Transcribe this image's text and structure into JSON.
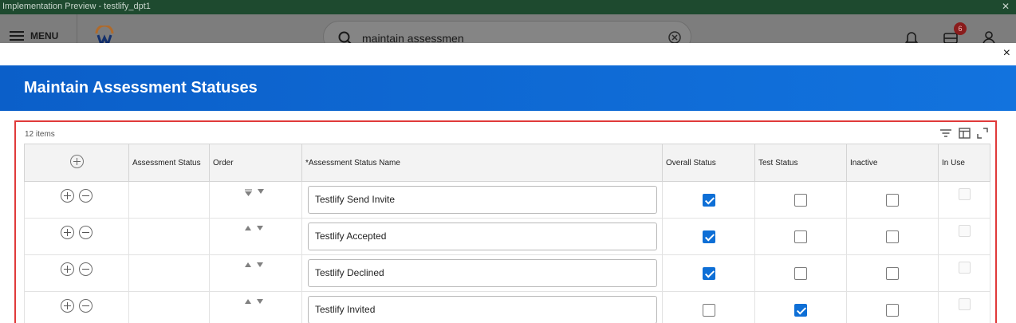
{
  "window": {
    "title": "Implementation Preview - testlify_dpt1",
    "close_icon": "close-icon"
  },
  "appbar": {
    "menu_label": "MENU",
    "search_value": "maintain assessmen",
    "notification_badge": "6",
    "icons": [
      "hamburger-icon",
      "workday-logo",
      "search-icon",
      "clear-icon",
      "bell-icon",
      "inbox-icon",
      "user-icon"
    ]
  },
  "modal": {
    "title": "Maintain Assessment Statuses",
    "close_label": "×"
  },
  "grid": {
    "items_count": "12 items",
    "columns": {
      "assessment_status": "Assessment Status",
      "order": "Order",
      "name": "*Assessment Status Name",
      "overall": "Overall Status",
      "test": "Test Status",
      "inactive": "Inactive",
      "in_use": "In Use"
    },
    "rows": [
      {
        "name": "Testlify Send Invite",
        "overall": true,
        "test": false,
        "inactive": false,
        "in_use": false
      },
      {
        "name": "Testlify Accepted",
        "overall": true,
        "test": false,
        "inactive": false,
        "in_use": false
      },
      {
        "name": "Testlify Declined",
        "overall": true,
        "test": false,
        "inactive": false,
        "in_use": false
      },
      {
        "name": "Testlify Invited",
        "overall": false,
        "test": true,
        "inactive": false,
        "in_use": false
      }
    ]
  },
  "colors": {
    "accent": "#0e6fd6",
    "header_gradient_start": "#0b5fc9",
    "highlight_border": "#e03a3a"
  }
}
